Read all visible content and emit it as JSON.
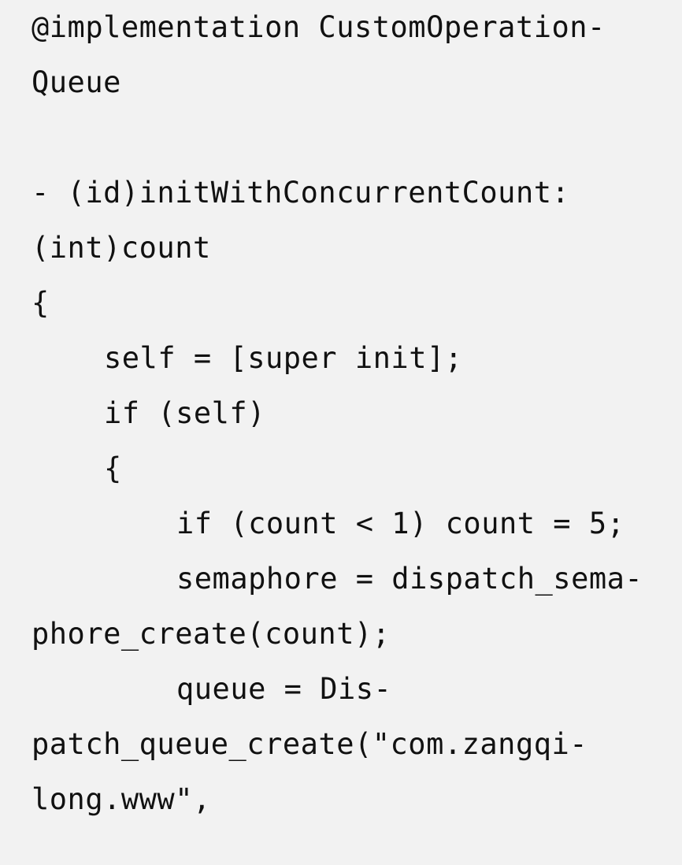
{
  "code": {
    "lines": [
      "@implementation CustomOperation-",
      "Queue",
      "",
      "- (id)initWithConcurrentCount:",
      "(int)count",
      "{",
      "self = [super init];",
      "if (self)",
      "{",
      "if (count < 1) count = 5;",
      "semaphore = dispatch_sema-",
      "phore_create(count);",
      "queue = Dis-",
      "patch_queue_create(\"com.zangqi-",
      "long.www\","
    ]
  }
}
